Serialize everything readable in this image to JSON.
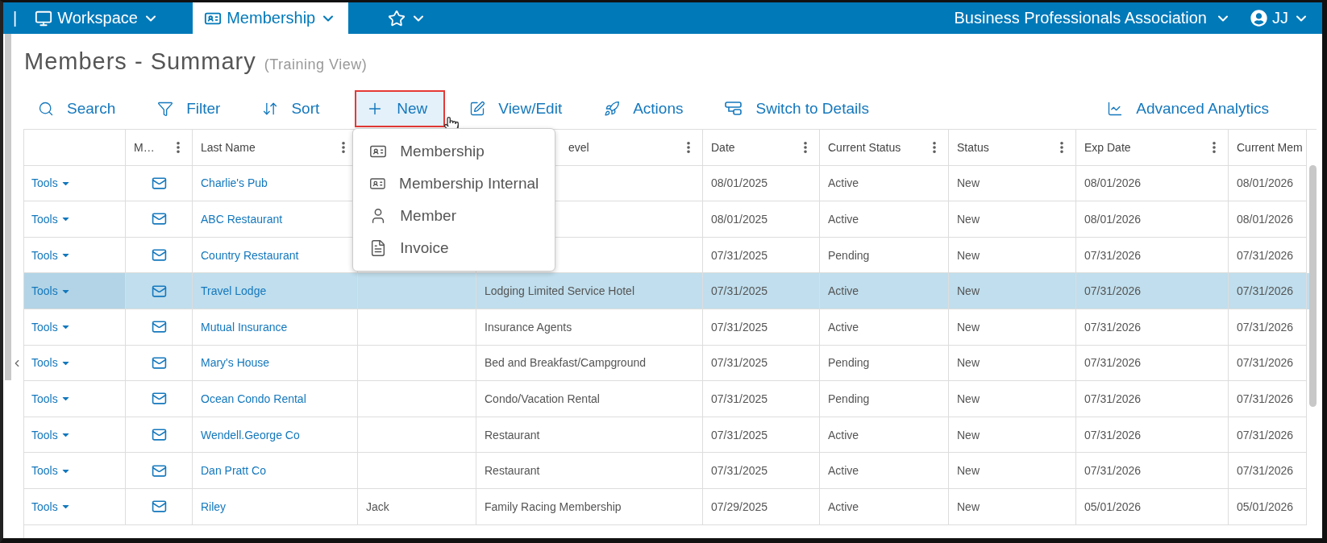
{
  "nav": [
    {
      "kind": "workspace",
      "label": "Workspace",
      "selected": false
    },
    {
      "kind": "membership",
      "label": "Membership",
      "selected": true
    },
    {
      "kind": "favorites",
      "selected": false
    }
  ],
  "separator": "|",
  "organization": "Business Professionals Association",
  "user": "JJ",
  "page": {
    "title": "Members - Summary",
    "subtitle": "(Training View)"
  },
  "toolbar": [
    {
      "kind": "search",
      "label": "Search",
      "selected": false
    },
    {
      "kind": "filter",
      "label": "Filter",
      "selected": false
    },
    {
      "kind": "sort",
      "label": "Sort",
      "selected": false
    },
    {
      "kind": "new",
      "label": "New",
      "selected": true
    },
    {
      "kind": "edit",
      "label": "View/Edit",
      "selected": false
    },
    {
      "kind": "actions",
      "label": "Actions",
      "selected": false
    },
    {
      "kind": "switch",
      "label": "Switch to Details",
      "selected": false
    },
    {
      "kind": "analytics",
      "label": "Advanced Analytics",
      "selected": false
    }
  ],
  "new_menu": [
    {
      "kind": "card",
      "label": "Membership"
    },
    {
      "kind": "card",
      "label": "Membership Internal"
    },
    {
      "kind": "person",
      "label": "Member"
    },
    {
      "kind": "document",
      "label": "Invoice"
    }
  ],
  "table": {
    "columns": [
      {
        "menu": false
      },
      {
        "label": "M…",
        "menu": true
      },
      {
        "label": "Last Name",
        "menu": true
      },
      {},
      {
        "label": "evel",
        "menu": true
      },
      {
        "label": "Date",
        "menu": true
      },
      {
        "label": "Current Status",
        "menu": true
      },
      {
        "label": "Status",
        "menu": true
      },
      {
        "label": "Exp Date",
        "menu": true
      },
      {
        "label": "Current Mem",
        "menu": false
      }
    ],
    "rows": [
      {
        "tools": "Tools",
        "name": "Charlie's Pub",
        "date": "08/01/2025",
        "current_status": "Active",
        "status": "New",
        "exp_date": "08/01/2026",
        "current_mem": "08/01/2026",
        "selected": false
      },
      {
        "tools": "Tools",
        "name": "ABC Restaurant",
        "date": "08/01/2025",
        "current_status": "Active",
        "status": "New",
        "exp_date": "08/01/2026",
        "current_mem": "08/01/2026",
        "selected": false
      },
      {
        "tools": "Tools",
        "name": "Country Restaurant",
        "date": "07/31/2025",
        "current_status": "Pending",
        "status": "New",
        "exp_date": "07/31/2026",
        "current_mem": "07/31/2026",
        "selected": false
      },
      {
        "tools": "Tools",
        "name": "Travel Lodge",
        "type": "Lodging Limited Service Hotel",
        "date": "07/31/2025",
        "current_status": "Active",
        "status": "New",
        "exp_date": "07/31/2026",
        "current_mem": "07/31/2026",
        "selected": true
      },
      {
        "tools": "Tools",
        "name": "Mutual Insurance",
        "type": "Insurance Agents",
        "date": "07/31/2025",
        "current_status": "Active",
        "status": "New",
        "exp_date": "07/31/2026",
        "current_mem": "07/31/2026",
        "selected": false
      },
      {
        "tools": "Tools",
        "name": "Mary's House",
        "type": "Bed and Breakfast/Campground",
        "date": "07/31/2025",
        "current_status": "Pending",
        "status": "New",
        "exp_date": "07/31/2026",
        "current_mem": "07/31/2026",
        "selected": false
      },
      {
        "tools": "Tools",
        "name": "Ocean Condo Rental",
        "type": "Condo/Vacation Rental",
        "date": "07/31/2025",
        "current_status": "Pending",
        "status": "New",
        "exp_date": "07/31/2026",
        "current_mem": "07/31/2026",
        "selected": false
      },
      {
        "tools": "Tools",
        "name": "Wendell.George Co",
        "type": "Restaurant",
        "date": "07/31/2025",
        "current_status": "Active",
        "status": "New",
        "exp_date": "07/31/2026",
        "current_mem": "07/31/2026",
        "selected": false
      },
      {
        "tools": "Tools",
        "name": "Dan Pratt Co",
        "type": "Restaurant",
        "date": "07/31/2025",
        "current_status": "Active",
        "status": "New",
        "exp_date": "07/31/2026",
        "current_mem": "07/31/2026",
        "selected": false
      },
      {
        "tools": "Tools",
        "name": "Riley",
        "first": "Jack",
        "type": "Family Racing Membership",
        "date": "07/29/2025",
        "current_status": "Active",
        "status": "New",
        "exp_date": "05/01/2026",
        "current_mem": "05/01/2026",
        "selected": false
      }
    ]
  }
}
